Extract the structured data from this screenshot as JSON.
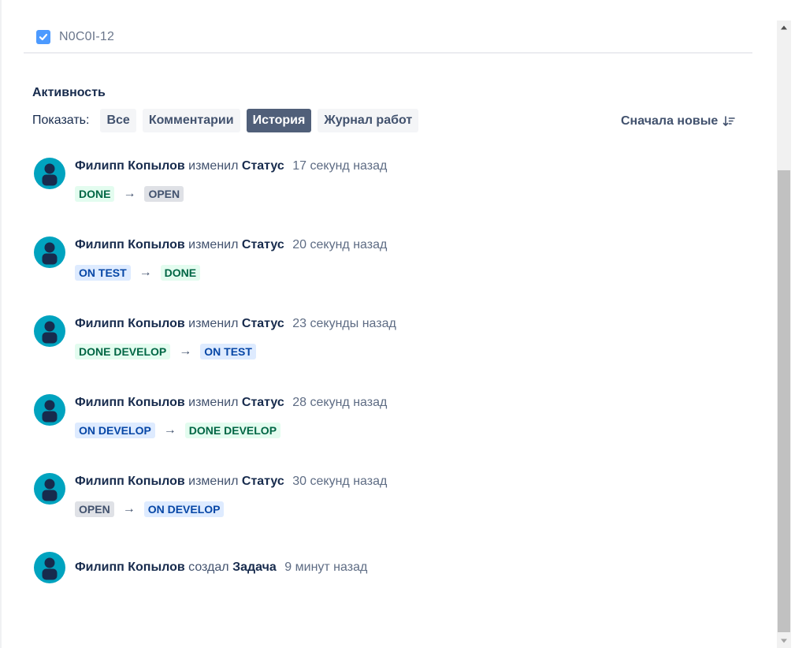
{
  "issue": {
    "key": "N0C0I-12"
  },
  "activity": {
    "title": "Активность",
    "show_label": "Показать:",
    "filters": [
      {
        "label": "Все",
        "active": false
      },
      {
        "label": "Комментарии",
        "active": false
      },
      {
        "label": "История",
        "active": true
      },
      {
        "label": "Журнал работ",
        "active": false
      }
    ],
    "sort_label": "Сначала новые"
  },
  "arrow_glyph": "→",
  "entries": [
    {
      "author": "Филипп Копылов",
      "action": "изменил",
      "field": "Статус",
      "time": "17 секунд назад",
      "from": {
        "label": "DONE",
        "style": "done"
      },
      "to": {
        "label": "OPEN",
        "style": "open"
      }
    },
    {
      "author": "Филипп Копылов",
      "action": "изменил",
      "field": "Статус",
      "time": "20 секунд назад",
      "from": {
        "label": "ON TEST",
        "style": "blue"
      },
      "to": {
        "label": "DONE",
        "style": "done"
      }
    },
    {
      "author": "Филипп Копылов",
      "action": "изменил",
      "field": "Статус",
      "time": "23 секунды назад",
      "from": {
        "label": "DONE DEVELOP",
        "style": "done"
      },
      "to": {
        "label": "ON TEST",
        "style": "blue"
      }
    },
    {
      "author": "Филипп Копылов",
      "action": "изменил",
      "field": "Статус",
      "time": "28 секунд назад",
      "from": {
        "label": "ON DEVELOP",
        "style": "blue"
      },
      "to": {
        "label": "DONE DEVELOP",
        "style": "done"
      }
    },
    {
      "author": "Филипп Копылов",
      "action": "изменил",
      "field": "Статус",
      "time": "30 секунд назад",
      "from": {
        "label": "OPEN",
        "style": "open"
      },
      "to": {
        "label": "ON DEVELOP",
        "style": "blue"
      }
    },
    {
      "author": "Филипп Копылов",
      "action": "создал",
      "field": "Задача",
      "time": "9 минут назад"
    }
  ],
  "colors": {
    "avatar": "#00a3bf",
    "active_filter": "#505f79",
    "done_lozenge": "#e3fcef",
    "open_lozenge": "#dfe1e6",
    "blue_lozenge": "#deebff"
  }
}
